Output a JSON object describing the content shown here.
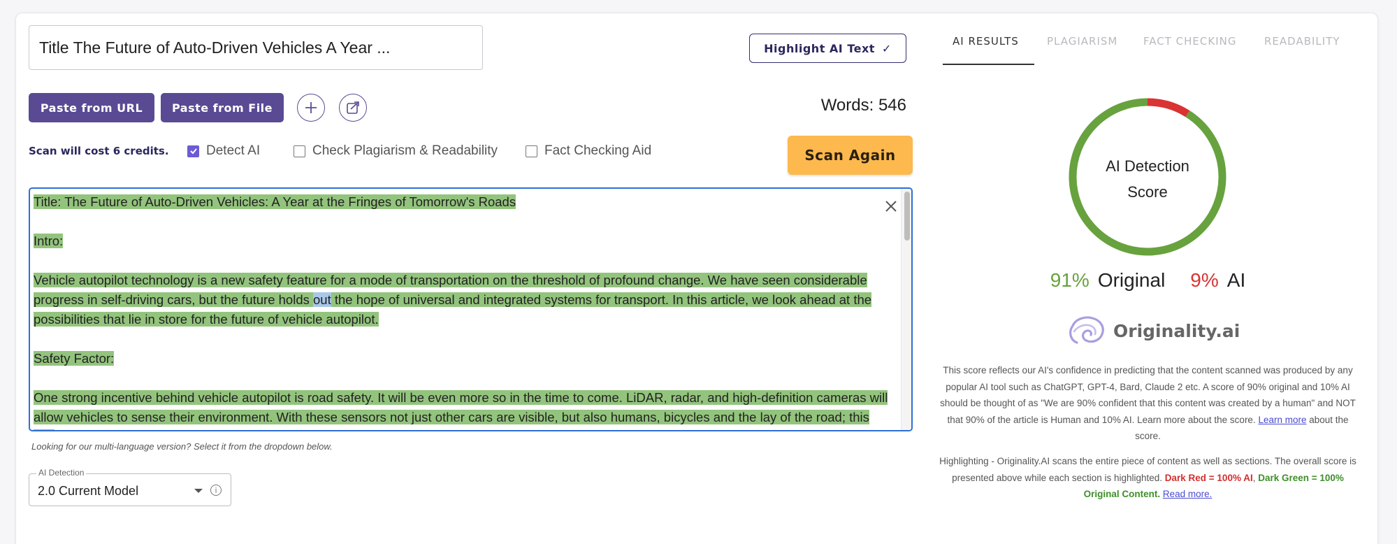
{
  "title_input": {
    "value": "Title The Future of Auto-Driven Vehicles A Year ..."
  },
  "toolbar": {
    "highlight_label": "Highlight AI Text",
    "paste_url_label": "Paste from URL",
    "paste_file_label": "Paste from File",
    "add_icon": "plus-icon",
    "share_icon": "share-icon"
  },
  "words_label": "Words: 546",
  "scan": {
    "cost_label": "Scan will cost 6 credits.",
    "options": [
      {
        "label": "Detect AI",
        "checked": true
      },
      {
        "label": "Check Plagiarism & Readability",
        "checked": false
      },
      {
        "label": "Fact Checking Aid",
        "checked": false
      }
    ],
    "scan_button_label": "Scan Again"
  },
  "editor": {
    "title_line": "Title: The Future of Auto-Driven Vehicles: A Year at the Fringes of Tomorrow's Roads",
    "intro_heading": "Intro:",
    "para1_before": "Vehicle autopilot technology is a new safety feature for a mode of transportation on the threshold of profound change. We have seen considerable progress in self-driving cars, but the future holds ",
    "para1_selected": "out",
    "para1_after": " the hope of universal and integrated systems for transport. In this article, we look ahead at the possibilities that lie in store for the future of vehicle autopilot.",
    "safety_heading": "Safety Factor:",
    "para2": "One strong incentive behind vehicle autopilot is road safety. It will be even more so in the time to come. LiDAR, radar, and high-definition cameras will allow vehicles to sense their environment. With these sensors not just other cars are visible, but also humans, bicycles and the lay of the road; this can"
  },
  "hint": "Looking for our multi-language version? Select it from the dropdown below.",
  "model_select": {
    "label": "AI Detection",
    "value": "2.0 Current Model"
  },
  "tabs": [
    {
      "label": "AI RESULTS",
      "active": true
    },
    {
      "label": "PLAGIARISM",
      "active": false
    },
    {
      "label": "FACT CHECKING",
      "active": false
    },
    {
      "label": "READABILITY",
      "active": false
    }
  ],
  "score": {
    "donut_label_line1": "AI Detection",
    "donut_label_line2": "Score",
    "original_fraction": 0.91,
    "ai_fraction": 0.09,
    "original_pct": "91%",
    "original_text": "Original",
    "ai_pct": "9%",
    "ai_text": "AI",
    "colors": {
      "original": "#67a23e",
      "ai": "#d93333"
    }
  },
  "brand": {
    "name": "Originality.ai",
    "icon": "brain-logo-icon"
  },
  "description": {
    "text": "This score reflects our AI's confidence in predicting that the content scanned was produced by any popular AI tool such as ChatGPT, GPT-4, Bard, Claude 2 etc. A score of 90% original and 10% AI should be thought of as \"We are 90% confident that this content was created by a human\" and NOT that 90% of the article is Human and 10% AI. Learn more about the score. ",
    "link": "Learn more",
    "after_link": " about the score."
  },
  "highlighting": {
    "text": "Highlighting - Originality.AI scans the entire piece of content as well as sections. The overall score is presented above while each section is highlighted. ",
    "dark_red": "Dark Red = 100% AI",
    "comma": ", ",
    "dark_green": "Dark Green = 100% Original Content.",
    "read_more": "Read more."
  }
}
